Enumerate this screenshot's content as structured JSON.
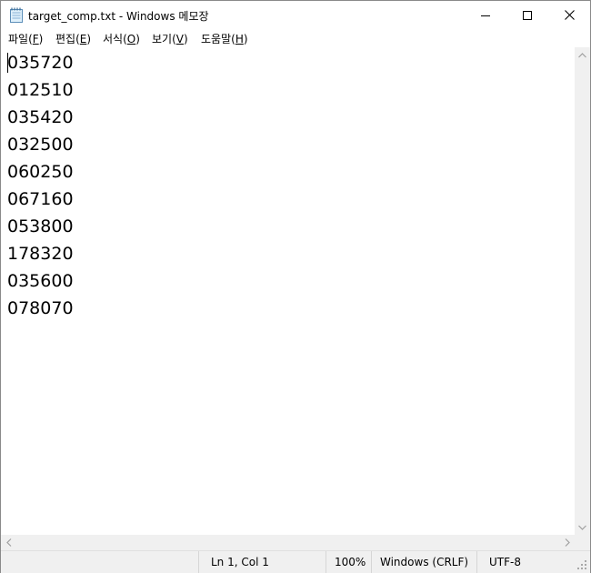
{
  "window": {
    "title": "target_comp.txt - Windows 메모장",
    "icon": "notepad-icon"
  },
  "menu": [
    {
      "label": "파일(",
      "mnemonic": "F",
      "suffix": ")"
    },
    {
      "label": "편집(",
      "mnemonic": "E",
      "suffix": ")"
    },
    {
      "label": "서식(",
      "mnemonic": "O",
      "suffix": ")"
    },
    {
      "label": "보기(",
      "mnemonic": "V",
      "suffix": ")"
    },
    {
      "label": "도움말(",
      "mnemonic": "H",
      "suffix": ")"
    }
  ],
  "editor": {
    "lines": [
      "035720",
      "012510",
      "035420",
      "032500",
      "060250",
      "067160",
      "053800",
      "178320",
      "035600",
      "078070"
    ]
  },
  "status": {
    "position": "Ln 1, Col 1",
    "zoom": "100%",
    "line_ending": "Windows (CRLF)",
    "encoding": "UTF-8"
  }
}
